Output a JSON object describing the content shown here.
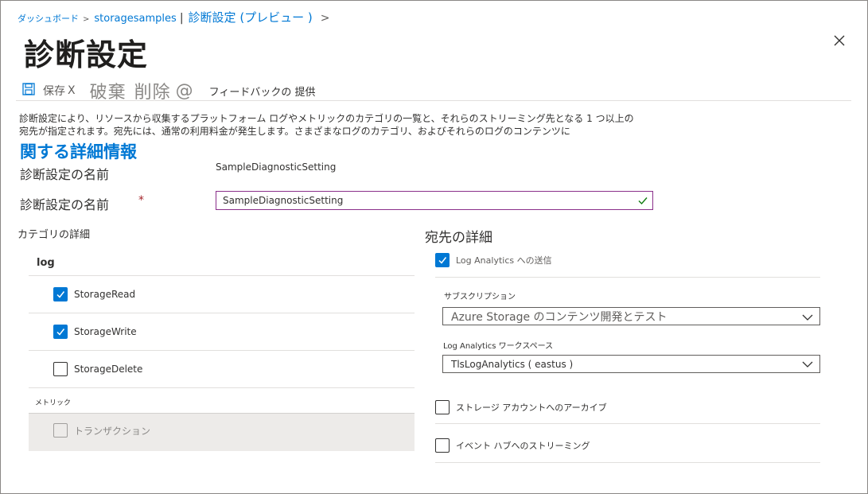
{
  "breadcrumb": {
    "home": "ダッシュボード",
    "separator": ">",
    "resource": "storagesamples",
    "divider": "|",
    "current": "診断設定 (プレビュー )",
    "chevron": ">"
  },
  "page": {
    "title": "診断設定"
  },
  "toolbar": {
    "save_label": "保存",
    "save_x": "X",
    "discard_label": "破棄",
    "delete_label": "削除",
    "at_symbol": "@",
    "feedback_label": "フィードバックの 提供"
  },
  "description": {
    "text": "診断設定により、リソースから収集するプラットフォーム ログやメトリックのカテゴリの一覧と、それらのストリーミング先となる 1 つ以上の宛先が指定されます。宛先には、通常の利用料金が発生します。さまざまなログのカテゴリ、およびそれらのログのコンテンツに",
    "learn_more": "関する詳細情報"
  },
  "form": {
    "name_label_readonly": "診断設定の名前",
    "name_value_readonly": "SampleDiagnosticSetting",
    "name_label": "診断設定の名前",
    "required_marker": "*",
    "name_value": "SampleDiagnosticSetting"
  },
  "categories": {
    "title": "カテゴリの詳細",
    "log_header": "log",
    "items": [
      {
        "label": "StorageRead",
        "checked": true
      },
      {
        "label": "StorageWrite",
        "checked": true
      },
      {
        "label": "StorageDelete",
        "checked": false
      }
    ],
    "metric_header": "メトリック",
    "metric_item": "トランザクション"
  },
  "destination": {
    "title": "宛先の詳細",
    "log_analytics": {
      "label": "Log Analytics への送信",
      "checked": true
    },
    "subscription_label": "サブスクリプション",
    "subscription_value": "Azure  Storage のコンテンツ開発とテスト",
    "workspace_label": "Log Analytics ワークスペース",
    "workspace_value": "TlsLogAnalytics ( eastus )",
    "archive": {
      "label": "ストレージ アカウントへのアーカイブ",
      "checked": false
    },
    "eventhub": {
      "label": "イベント ハブへのストリーミング",
      "checked": false
    }
  },
  "colors": {
    "accent": "#0078d4",
    "input_border": "#8a2f8a",
    "valid_check": "#107c10",
    "required": "#a4262c"
  }
}
